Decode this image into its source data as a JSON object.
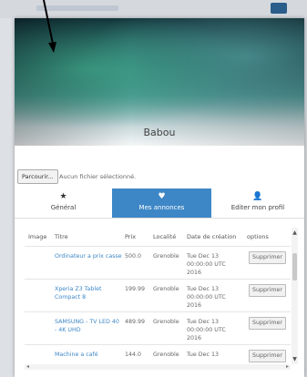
{
  "profile": {
    "name": "Babou"
  },
  "upload": {
    "browse_label": "Parcourir...",
    "no_file_text": "Aucun fichier sélectionné."
  },
  "tabs": [
    {
      "label": "Général",
      "icon": "star-icon",
      "glyph": "★",
      "active": false
    },
    {
      "label": "Mes annonces",
      "icon": "heart-icon",
      "glyph": "♥",
      "active": true
    },
    {
      "label": "Editer mon profil",
      "icon": "user-icon",
      "glyph": "👤",
      "active": false
    }
  ],
  "table": {
    "headers": [
      "Image",
      "Titre",
      "Prix",
      "Localité",
      "Date de création",
      "options"
    ],
    "delete_label": "Supprimer",
    "rows": [
      {
        "title": "Ordinateur a prix casse",
        "price": "500.0",
        "location": "Grenoble",
        "date": "Tue Dec 13 00:00:00 UTC 2016"
      },
      {
        "title": "Xperia Z3 Tablet Compact 8",
        "price": "199.99",
        "location": "Grenoble",
        "date": "Tue Dec 13 00:00:00 UTC 2016"
      },
      {
        "title": "SAMSUNG - TV LED 40 - 4K UHD",
        "price": "489.99",
        "location": "Grenoble",
        "date": "Tue Dec 13 00:00:00 UTC 2016"
      },
      {
        "title": "Machine a café",
        "price": "144.0",
        "location": "Grenoble",
        "date": "Tue Dec 13"
      }
    ]
  },
  "colors": {
    "accent": "#3d87c6",
    "link": "#3d87c6"
  }
}
